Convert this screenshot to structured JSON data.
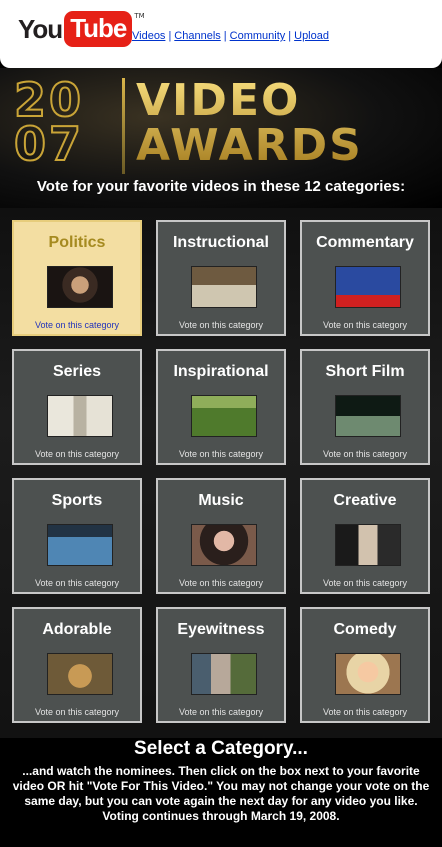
{
  "header": {
    "logo_you": "You",
    "logo_tube": "Tube",
    "logo_tm": "TM",
    "nav": [
      {
        "label": "Videos"
      },
      {
        "label": "Channels"
      },
      {
        "label": "Community"
      },
      {
        "label": "Upload"
      }
    ],
    "nav_separator": "|"
  },
  "banner": {
    "year_top": "20",
    "year_bottom": "07",
    "title_top": "VIDEO",
    "title_bottom": "AWARDS",
    "tagline": "Vote for your favorite videos in these 12 categories:",
    "accent_color": "#c9a437"
  },
  "categories": [
    {
      "name": "Politics",
      "vote": "Vote on this category",
      "selected": true,
      "thumb": "politics-thumbnail"
    },
    {
      "name": "Instructional",
      "vote": "Vote on this category",
      "selected": false,
      "thumb": "instructional-thumbnail"
    },
    {
      "name": "Commentary",
      "vote": "Vote on this category",
      "selected": false,
      "thumb": "commentary-thumbnail"
    },
    {
      "name": "Series",
      "vote": "Vote on this category",
      "selected": false,
      "thumb": "series-thumbnail"
    },
    {
      "name": "Inspirational",
      "vote": "Vote on this category",
      "selected": false,
      "thumb": "inspirational-thumbnail"
    },
    {
      "name": "Short Film",
      "vote": "Vote on this category",
      "selected": false,
      "thumb": "short-film-thumbnail"
    },
    {
      "name": "Sports",
      "vote": "Vote on this category",
      "selected": false,
      "thumb": "sports-thumbnail"
    },
    {
      "name": "Music",
      "vote": "Vote on this category",
      "selected": false,
      "thumb": "music-thumbnail"
    },
    {
      "name": "Creative",
      "vote": "Vote on this category",
      "selected": false,
      "thumb": "creative-thumbnail"
    },
    {
      "name": "Adorable",
      "vote": "Vote on this category",
      "selected": false,
      "thumb": "adorable-thumbnail"
    },
    {
      "name": "Eyewitness",
      "vote": "Vote on this category",
      "selected": false,
      "thumb": "eyewitness-thumbnail"
    },
    {
      "name": "Comedy",
      "vote": "Vote on this category",
      "selected": false,
      "thumb": "comedy-thumbnail"
    }
  ],
  "footer": {
    "title": "Select a Category...",
    "instructions": "...and watch the nominees. Then click on the box next to your favorite video OR hit \"Vote For This Video.\" You may not change your vote on the same day, but you can vote again the next day for any video you like. Voting continues through March 19, 2008."
  }
}
